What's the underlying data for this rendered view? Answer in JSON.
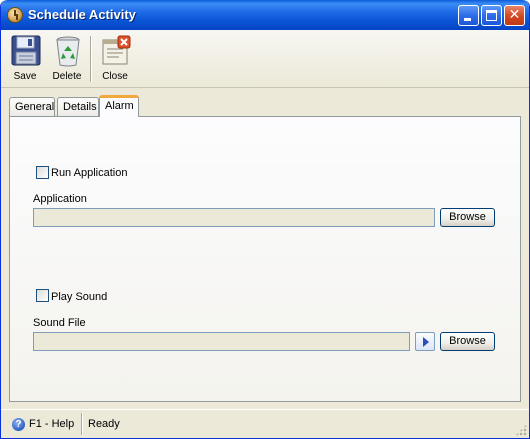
{
  "window": {
    "title": "Schedule Activity"
  },
  "toolbar": {
    "save_label": "Save",
    "delete_label": "Delete",
    "close_label": "Close"
  },
  "tabs": [
    {
      "label": "General",
      "active": false
    },
    {
      "label": "Details",
      "active": false
    },
    {
      "label": "Alarm",
      "active": true
    }
  ],
  "alarm": {
    "run_application": {
      "label": "Run Application",
      "checked": false
    },
    "application": {
      "label": "Application",
      "value": "",
      "browse_label": "Browse"
    },
    "play_sound": {
      "label": "Play Sound",
      "checked": false
    },
    "sound_file": {
      "label": "Sound File",
      "value": "",
      "play_icon": "play-icon",
      "browse_label": "Browse"
    }
  },
  "statusbar": {
    "help_text": "F1 - Help",
    "status_text": "Ready"
  },
  "colors": {
    "titlebar": "#0a55d5",
    "window_bg": "#ece9d8",
    "active_tab_accent": "#f1a93d",
    "close_button": "#d2461f"
  }
}
